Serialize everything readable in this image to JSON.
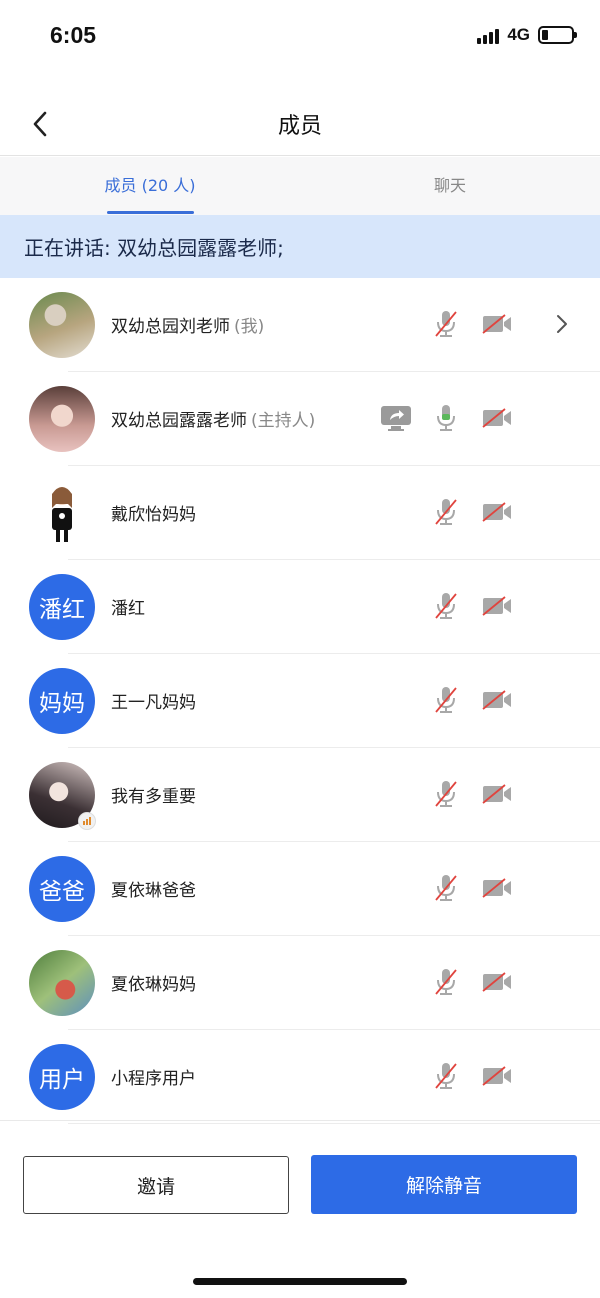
{
  "status_bar": {
    "time": "6:05",
    "network": "4G"
  },
  "nav": {
    "title": "成员"
  },
  "tabs": [
    {
      "label": "成员 (20 人)",
      "active": true
    },
    {
      "label": "聊天",
      "active": false
    }
  ],
  "speaking_banner": "正在讲话: 双幼总园露露老师;",
  "members": [
    {
      "name": "双幼总园刘老师",
      "role": "(我)",
      "avatar_text": "",
      "mic": "muted",
      "camera": "off"
    },
    {
      "name": "双幼总园露露老师",
      "role": "(主持人)",
      "avatar_text": "",
      "mic": "active",
      "camera": "off",
      "sharing": true
    },
    {
      "name": "戴欣怡妈妈",
      "role": "",
      "avatar_text": "",
      "mic": "muted",
      "camera": "off"
    },
    {
      "name": "潘红",
      "role": "",
      "avatar_text": "潘红",
      "mic": "muted",
      "camera": "off"
    },
    {
      "name": "王一凡妈妈",
      "role": "",
      "avatar_text": "妈妈",
      "mic": "muted",
      "camera": "off"
    },
    {
      "name": "我有多重要",
      "role": "",
      "avatar_text": "",
      "mic": "muted",
      "camera": "off"
    },
    {
      "name": "夏依琳爸爸",
      "role": "",
      "avatar_text": "爸爸",
      "mic": "muted",
      "camera": "off"
    },
    {
      "name": "夏依琳妈妈",
      "role": "",
      "avatar_text": "",
      "mic": "muted",
      "camera": "off"
    },
    {
      "name": "小程序用户",
      "role": "",
      "avatar_text": "用户",
      "mic": "muted",
      "camera": "off"
    }
  ],
  "buttons": {
    "invite": "邀请",
    "unmute_all": "解除静音"
  },
  "colors": {
    "accent": "#2d6be6",
    "banner": "#d7e6fb",
    "muted_slash": "#e0443e",
    "active_mic": "#5cb85c"
  },
  "icons": {
    "back": "back-arrow-icon",
    "mic_muted": "mic-muted-icon",
    "mic_active": "mic-icon",
    "camera_off": "camera-off-icon",
    "share": "screen-share-icon",
    "chevron": "chevron-right-icon"
  }
}
